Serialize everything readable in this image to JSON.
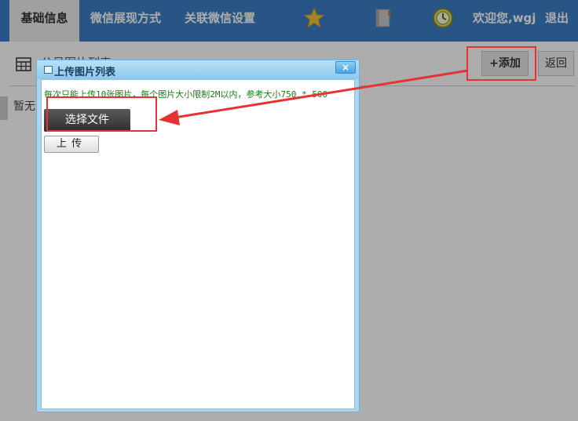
{
  "nav": {
    "tabs": [
      {
        "label": "基础信息",
        "active": true
      },
      {
        "label": "微信展现方式",
        "active": false
      },
      {
        "label": "关联微信设置",
        "active": false
      }
    ],
    "welcome": "欢迎您,wgj",
    "logout": "退出",
    "icons": [
      "star-icon",
      "book-icon",
      "clock-icon"
    ]
  },
  "page": {
    "title": "公号图片列表",
    "empty_text": "暂无",
    "add_button": "+添加",
    "back_button": "返回"
  },
  "dialog": {
    "title": "上传图片列表",
    "close_label": "×",
    "hint": "每次只能上传10张图片，每个图片大小限制2M以内，参考大小750 * 500",
    "choose_button": "选择文件",
    "upload_button": "上传"
  },
  "colors": {
    "nav_bg": "#3c7ec4",
    "dialog_frame": "#a9d6f2",
    "annotation": "#e53333",
    "hint_text": "#1a7a1a"
  }
}
